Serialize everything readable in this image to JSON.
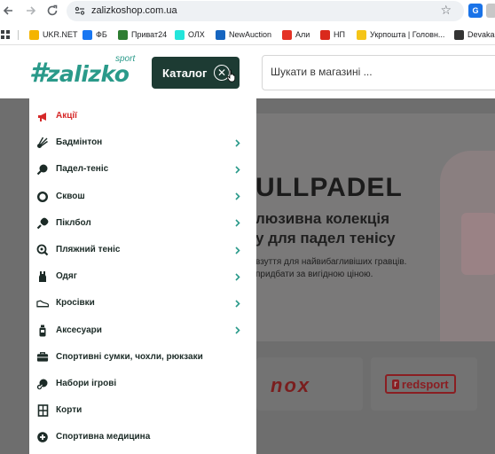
{
  "browser": {
    "url": "zalizkoshop.com.ua",
    "bookmarks": [
      {
        "label": "UKR.NET",
        "color": "#f4b400",
        "icon": "ukrnet-icon"
      },
      {
        "label": "ФБ",
        "color": "#1877f2",
        "icon": "facebook-icon"
      },
      {
        "label": "Приват24",
        "color": "#2e7d32",
        "icon": "privat24-icon"
      },
      {
        "label": "ОЛХ",
        "color": "#23e5db",
        "icon": "olx-icon"
      },
      {
        "label": "NewAuction",
        "color": "#1565c0",
        "icon": "newauction-icon"
      },
      {
        "label": "Али",
        "color": "#e43225",
        "icon": "aliexpress-icon"
      },
      {
        "label": "НП",
        "color": "#da291c",
        "icon": "novaposhta-icon"
      },
      {
        "label": "Укрпошта | Головн...",
        "color": "#f5c518",
        "icon": "ukrposhta-icon"
      },
      {
        "label": "Devaka",
        "color": "#333333",
        "icon": "devaka-icon"
      }
    ]
  },
  "header": {
    "logo_text": "zalizko",
    "logo_sport": "sport",
    "catalog_label": "Каталог",
    "search_placeholder": "Шукати в магазині ..."
  },
  "catalog": {
    "items": [
      {
        "label": "Акції",
        "icon": "megaphone-icon",
        "has_children": false,
        "highlight": true
      },
      {
        "label": "Бадмінтон",
        "icon": "shuttlecock-icon",
        "has_children": true
      },
      {
        "label": "Падел-теніс",
        "icon": "padel-racket-icon",
        "has_children": true
      },
      {
        "label": "Сквош",
        "icon": "squash-ball-icon",
        "has_children": true
      },
      {
        "label": "Піклбол",
        "icon": "pickleball-paddle-icon",
        "has_children": true
      },
      {
        "label": "Пляжний теніс",
        "icon": "beach-tennis-icon",
        "has_children": true
      },
      {
        "label": "Одяг",
        "icon": "clothing-icon",
        "has_children": true
      },
      {
        "label": "Кросівки",
        "icon": "sneaker-icon",
        "has_children": true
      },
      {
        "label": "Аксесуари",
        "icon": "bottle-icon",
        "has_children": true
      },
      {
        "label": "Спортивні сумки, чохли, рюкзаки",
        "icon": "bag-icon",
        "has_children": false
      },
      {
        "label": "Набори ігрові",
        "icon": "game-set-icon",
        "has_children": false
      },
      {
        "label": "Корти",
        "icon": "court-icon",
        "has_children": false
      },
      {
        "label": "Спортивна медицина",
        "icon": "medicine-icon",
        "has_children": false
      }
    ]
  },
  "banner": {
    "title": "ULLPADEL",
    "subtitle_1": "люзивна колекція",
    "subtitle_2": "у для падел тенісу",
    "text_1": "взуття для найвибагливіших гравців.",
    "text_2": "придбати за вигідною ціною."
  },
  "brands": {
    "nox": "nox",
    "redsport": "redsport"
  },
  "colors": {
    "brand_teal": "#2a9a8a",
    "catalog_button": "#1d3b33",
    "menu_text": "#1c2b27",
    "sale_red": "#d62828",
    "overlay": "#6e6e6e"
  }
}
